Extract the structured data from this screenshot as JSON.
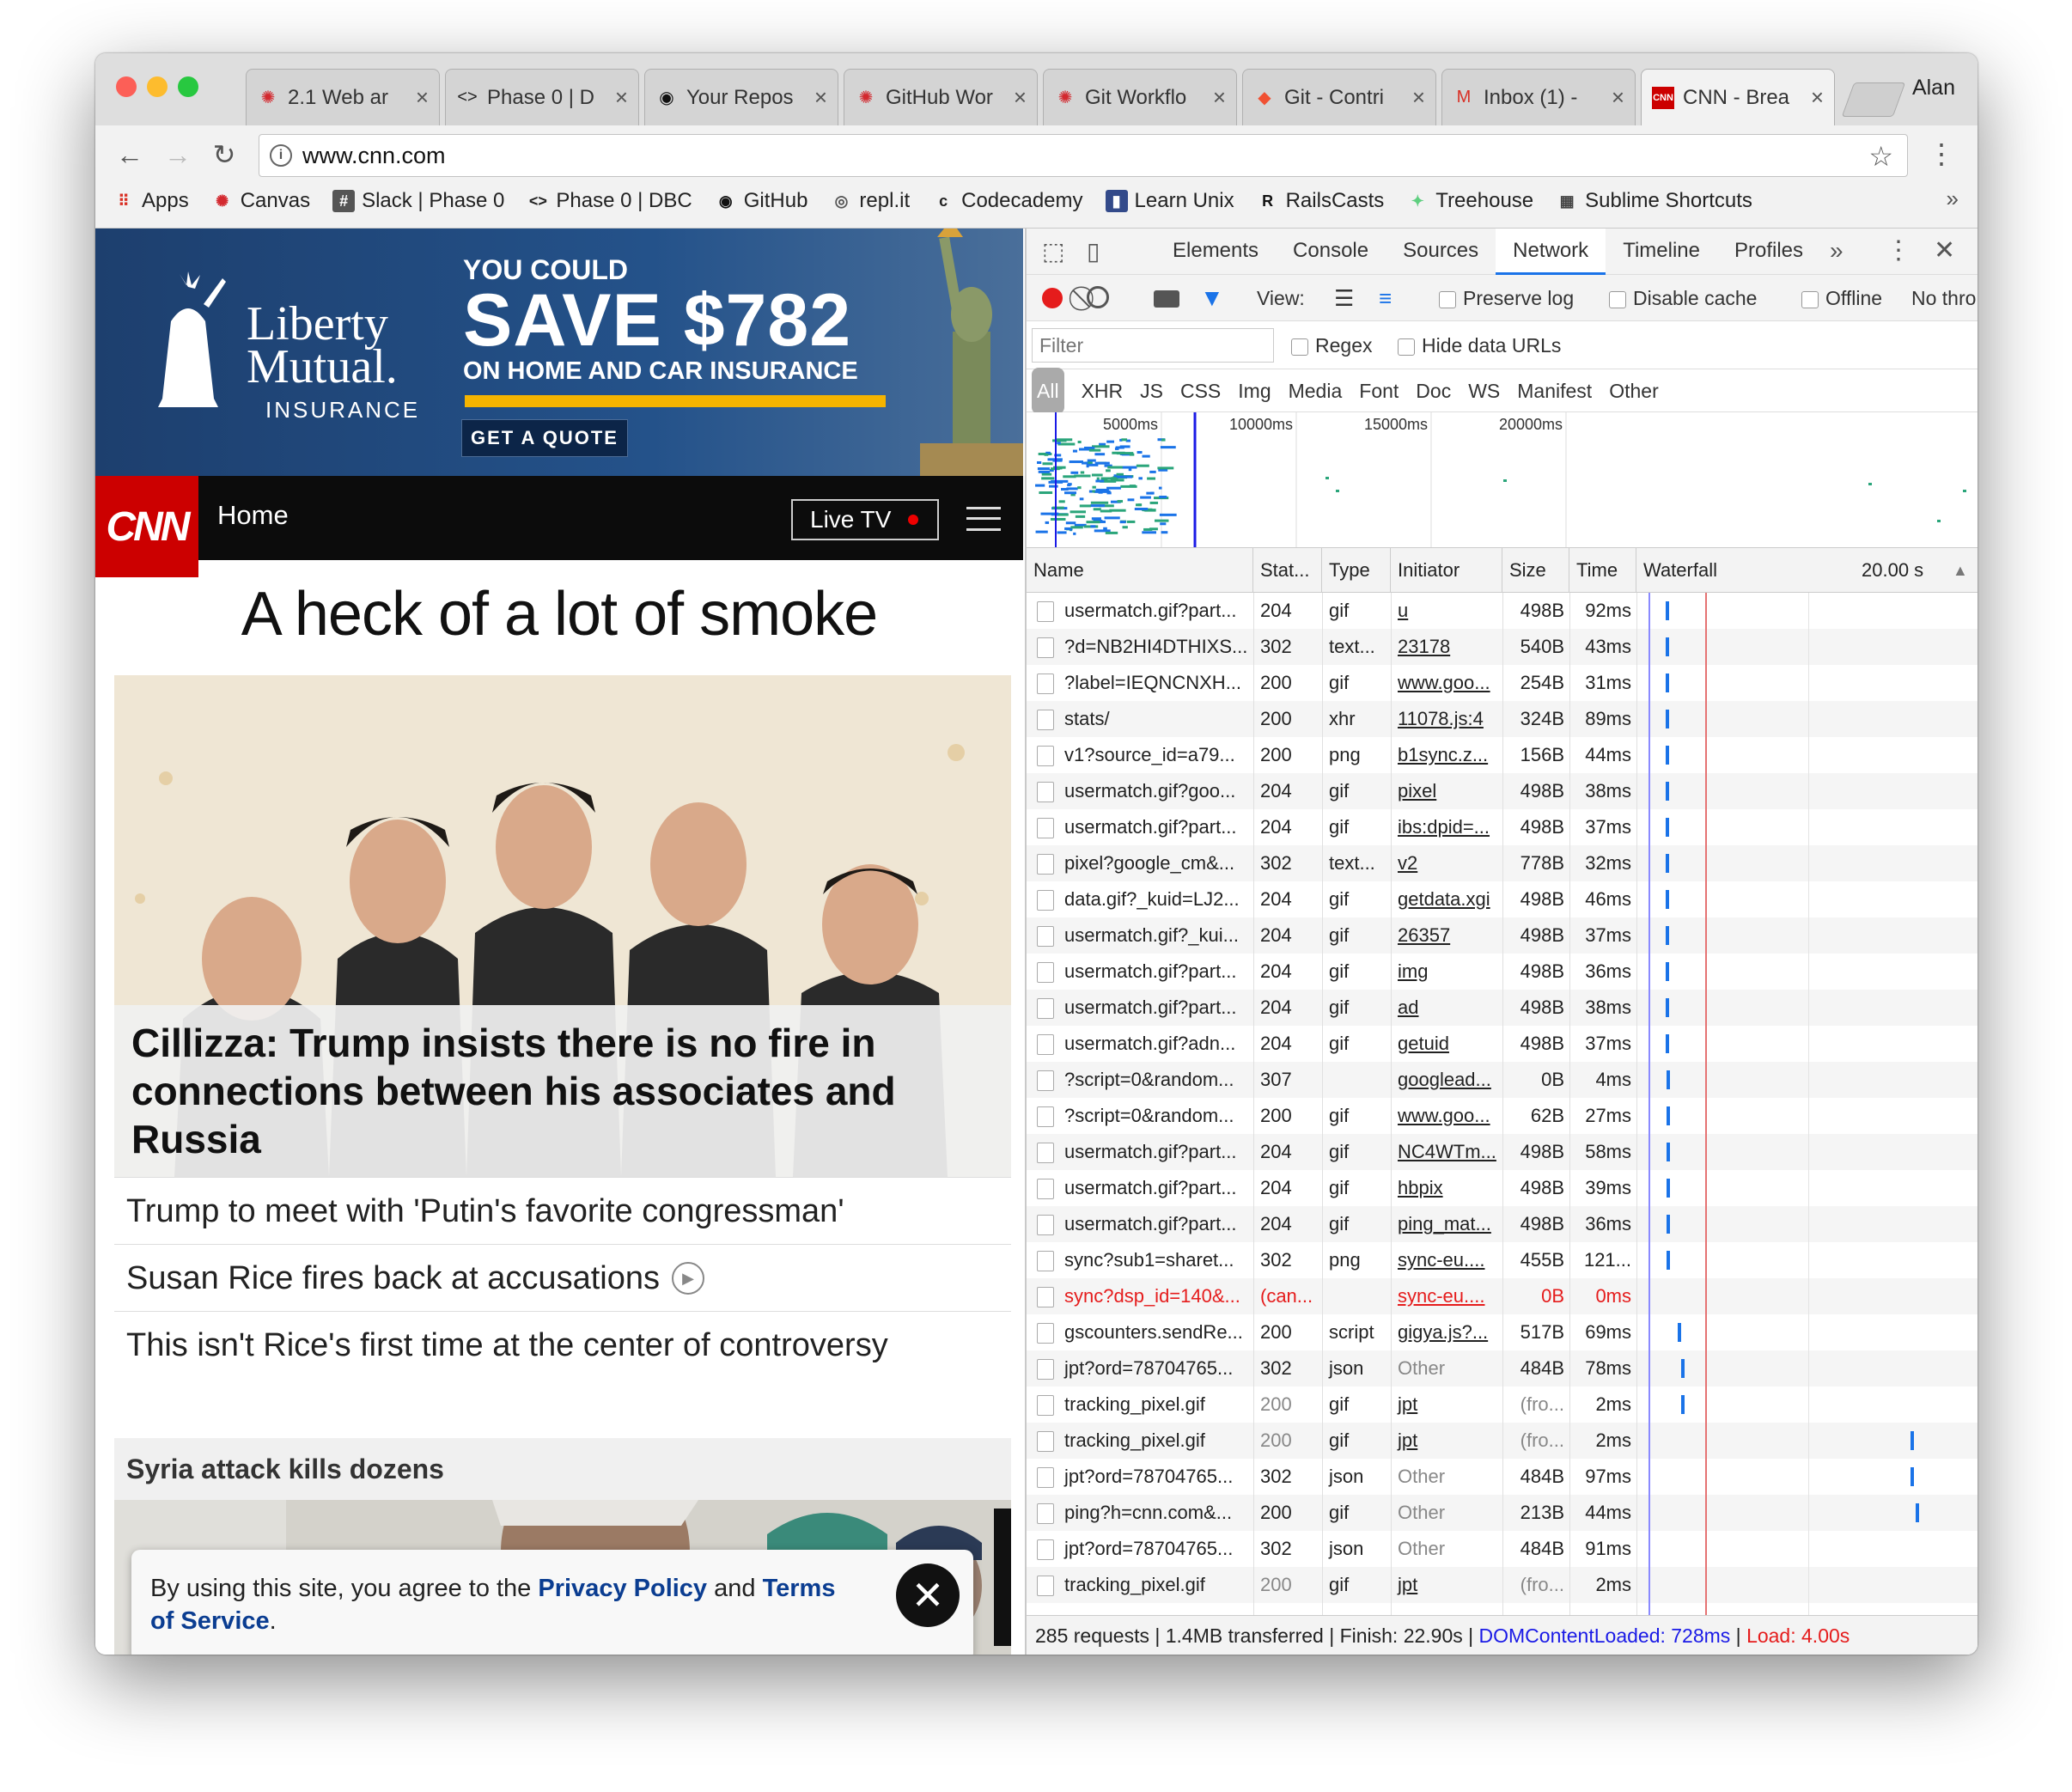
{
  "browser": {
    "tabs": [
      {
        "title": "2.1 Web ar",
        "icon": "canvas-icon"
      },
      {
        "title": "Phase 0 | D",
        "icon": "code-brackets-icon"
      },
      {
        "title": "Your Repos",
        "icon": "github-icon"
      },
      {
        "title": "GitHub Wor",
        "icon": "canvas-icon"
      },
      {
        "title": "Git Workflo",
        "icon": "canvas-icon"
      },
      {
        "title": "Git - Contri",
        "icon": "git-icon"
      },
      {
        "title": "Inbox (1) -",
        "icon": "gmail-icon"
      },
      {
        "title": "CNN - Brea",
        "icon": "cnn-icon",
        "active": true
      }
    ],
    "close_glyph": "×",
    "user": "Alan",
    "url": "www.cnn.com",
    "bookmarks": [
      {
        "label": "Apps",
        "icon": "apps-grid-icon"
      },
      {
        "label": "Canvas",
        "icon": "canvas-icon"
      },
      {
        "label": "Slack | Phase 0",
        "icon": "slack-icon"
      },
      {
        "label": "Phase 0 | DBC",
        "icon": "code-brackets-icon"
      },
      {
        "label": "GitHub",
        "icon": "github-icon"
      },
      {
        "label": "repl.it",
        "icon": "replit-icon"
      },
      {
        "label": "Codecademy",
        "icon": "codecademy-icon"
      },
      {
        "label": "Learn Unix",
        "icon": "unix-book-icon"
      },
      {
        "label": "RailsCasts",
        "icon": "railscasts-icon"
      },
      {
        "label": "Treehouse",
        "icon": "treehouse-icon"
      },
      {
        "label": "Sublime Shortcuts",
        "icon": "sublime-icon"
      }
    ],
    "more_bookmarks": "»"
  },
  "cnn": {
    "ad": {
      "brand_line1": "Liberty",
      "brand_line2": "Mutual.",
      "brand_line3": "INSURANCE",
      "headline_small": "YOU COULD",
      "headline_big": "SAVE $782",
      "headline_sub": "ON HOME AND CAR INSURANCE",
      "cta": "GET A QUOTE"
    },
    "logo": "CNN",
    "section": "Home",
    "live_tv": "Live TV",
    "headline": "A heck of a lot of smoke",
    "lead_caption": "Cillizza: Trump insists there is no fire in connections between his associates and Russia",
    "stories": [
      "Trump to meet with 'Putin's favorite congressman'",
      "Susan Rice fires back at accusations",
      "This isn't Rice's first time at the center of controversy"
    ],
    "section2": "Syria attack kills dozens",
    "cookie": {
      "pre": "By using this site, you agree to the ",
      "privacy": "Privacy Policy",
      "and": " and ",
      "terms": "Terms of Service",
      "end": "."
    }
  },
  "devtools": {
    "tabs": [
      "Elements",
      "Console",
      "Sources",
      "Network",
      "Timeline",
      "Profiles"
    ],
    "active_tab": "Network",
    "more": "»",
    "view_label": "View:",
    "preserve_log": "Preserve log",
    "disable_cache": "Disable cache",
    "offline": "Offline",
    "throttle": "No thro",
    "filter_placeholder": "Filter",
    "regex": "Regex",
    "hide_data_urls": "Hide data URLs",
    "type_filters": [
      "All",
      "XHR",
      "JS",
      "CSS",
      "Img",
      "Media",
      "Font",
      "Doc",
      "WS",
      "Manifest",
      "Other"
    ],
    "overview_ticks": [
      "5000ms",
      "10000ms",
      "15000ms",
      "20000ms"
    ],
    "columns": [
      "Name",
      "Stat...",
      "Type",
      "Initiator",
      "Size",
      "Time",
      "Waterfall"
    ],
    "waterfall_scale": "20.00 s",
    "sort_glyph": "▲",
    "requests": [
      {
        "name": "usermatch.gif?part...",
        "status": "204",
        "type": "gif",
        "initiator": "u",
        "size": "498B",
        "time": "92ms",
        "bar": 0.084
      },
      {
        "name": "?d=NB2HI4DTHIXS...",
        "status": "302",
        "type": "text...",
        "initiator": "23178",
        "size": "540B",
        "time": "43ms",
        "bar": 0.084
      },
      {
        "name": "?label=IEQNCNXH...",
        "status": "200",
        "type": "gif",
        "initiator": "www.goo...",
        "size": "254B",
        "time": "31ms",
        "bar": 0.084
      },
      {
        "name": "stats/",
        "status": "200",
        "type": "xhr",
        "initiator": "11078.js:4",
        "size": "324B",
        "time": "89ms",
        "bar": 0.085
      },
      {
        "name": "v1?source_id=a79...",
        "status": "200",
        "type": "png",
        "initiator": "b1sync.z...",
        "size": "156B",
        "time": "44ms",
        "bar": 0.085
      },
      {
        "name": "usermatch.gif?goo...",
        "status": "204",
        "type": "gif",
        "initiator": "pixel",
        "size": "498B",
        "time": "38ms",
        "bar": 0.085
      },
      {
        "name": "usermatch.gif?part...",
        "status": "204",
        "type": "gif",
        "initiator": "ibs:dpid=...",
        "size": "498B",
        "time": "37ms",
        "bar": 0.085
      },
      {
        "name": "pixel?google_cm&...",
        "status": "302",
        "type": "text...",
        "initiator": "v2",
        "size": "778B",
        "time": "32ms",
        "bar": 0.085
      },
      {
        "name": "data.gif?_kuid=LJ2...",
        "status": "204",
        "type": "gif",
        "initiator": "getdata.xgi",
        "size": "498B",
        "time": "46ms",
        "bar": 0.086
      },
      {
        "name": "usermatch.gif?_kui...",
        "status": "204",
        "type": "gif",
        "initiator": "26357",
        "size": "498B",
        "time": "37ms",
        "bar": 0.086
      },
      {
        "name": "usermatch.gif?part...",
        "status": "204",
        "type": "gif",
        "initiator": "img",
        "size": "498B",
        "time": "36ms",
        "bar": 0.086
      },
      {
        "name": "usermatch.gif?part...",
        "status": "204",
        "type": "gif",
        "initiator": "ad",
        "size": "498B",
        "time": "38ms",
        "bar": 0.086
      },
      {
        "name": "usermatch.gif?adn...",
        "status": "204",
        "type": "gif",
        "initiator": "getuid",
        "size": "498B",
        "time": "37ms",
        "bar": 0.086
      },
      {
        "name": "?script=0&random...",
        "status": "307",
        "type": "",
        "initiator": "googlead...",
        "size": "0B",
        "time": "4ms",
        "bar": 0.087
      },
      {
        "name": "?script=0&random...",
        "status": "200",
        "type": "gif",
        "initiator": "www.goo...",
        "size": "62B",
        "time": "27ms",
        "bar": 0.087
      },
      {
        "name": "usermatch.gif?part...",
        "status": "204",
        "type": "gif",
        "initiator": "NC4WTm...",
        "size": "498B",
        "time": "58ms",
        "bar": 0.087
      },
      {
        "name": "usermatch.gif?part...",
        "status": "204",
        "type": "gif",
        "initiator": "hbpix",
        "size": "498B",
        "time": "39ms",
        "bar": 0.087
      },
      {
        "name": "usermatch.gif?part...",
        "status": "204",
        "type": "gif",
        "initiator": "ping_mat...",
        "size": "498B",
        "time": "36ms",
        "bar": 0.087
      },
      {
        "name": "sync?sub1=sharet...",
        "status": "302",
        "type": "png",
        "initiator": "sync-eu....",
        "size": "455B",
        "time": "121...",
        "bar": 0.088
      },
      {
        "name": "sync?dsp_id=140&...",
        "status": "(can...",
        "type": "",
        "initiator": "sync-eu....",
        "size": "0B",
        "time": "0ms",
        "error": true
      },
      {
        "name": "gscounters.sendRe...",
        "status": "200",
        "type": "script",
        "initiator": "gigya.js?...",
        "size": "517B",
        "time": "69ms",
        "bar": 0.12
      },
      {
        "name": "jpt?ord=78704765...",
        "status": "302",
        "type": "json",
        "initiator": "Other",
        "size": "484B",
        "time": "78ms",
        "bar": 0.13
      },
      {
        "name": "tracking_pixel.gif",
        "status": "200",
        "type": "gif",
        "initiator": "jpt",
        "size": "(fro...",
        "time": "2ms",
        "bar": 0.13,
        "muted": true
      },
      {
        "name": "tracking_pixel.gif",
        "status": "200",
        "type": "gif",
        "initiator": "jpt",
        "size": "(fro...",
        "time": "2ms",
        "bar": 0.8,
        "muted": true
      },
      {
        "name": "jpt?ord=78704765...",
        "status": "302",
        "type": "json",
        "initiator": "Other",
        "size": "484B",
        "time": "97ms",
        "bar": 0.8
      },
      {
        "name": "ping?h=cnn.com&...",
        "status": "200",
        "type": "gif",
        "initiator": "Other",
        "size": "213B",
        "time": "44ms",
        "bar": 0.815
      },
      {
        "name": "jpt?ord=78704765...",
        "status": "302",
        "type": "json",
        "initiator": "Other",
        "size": "484B",
        "time": "91ms",
        "bar": 0.995
      },
      {
        "name": "tracking_pixel.gif",
        "status": "200",
        "type": "gif",
        "initiator": "jpt",
        "size": "(fro...",
        "time": "2ms",
        "bar": 0.995,
        "muted": true
      }
    ],
    "status_bar": {
      "summary": "285 requests | 1.4MB transferred | Finish: 22.90s | ",
      "dom": "DOMContentLoaded: 728ms",
      "sep": " | ",
      "load": "Load: 4.00s"
    }
  }
}
